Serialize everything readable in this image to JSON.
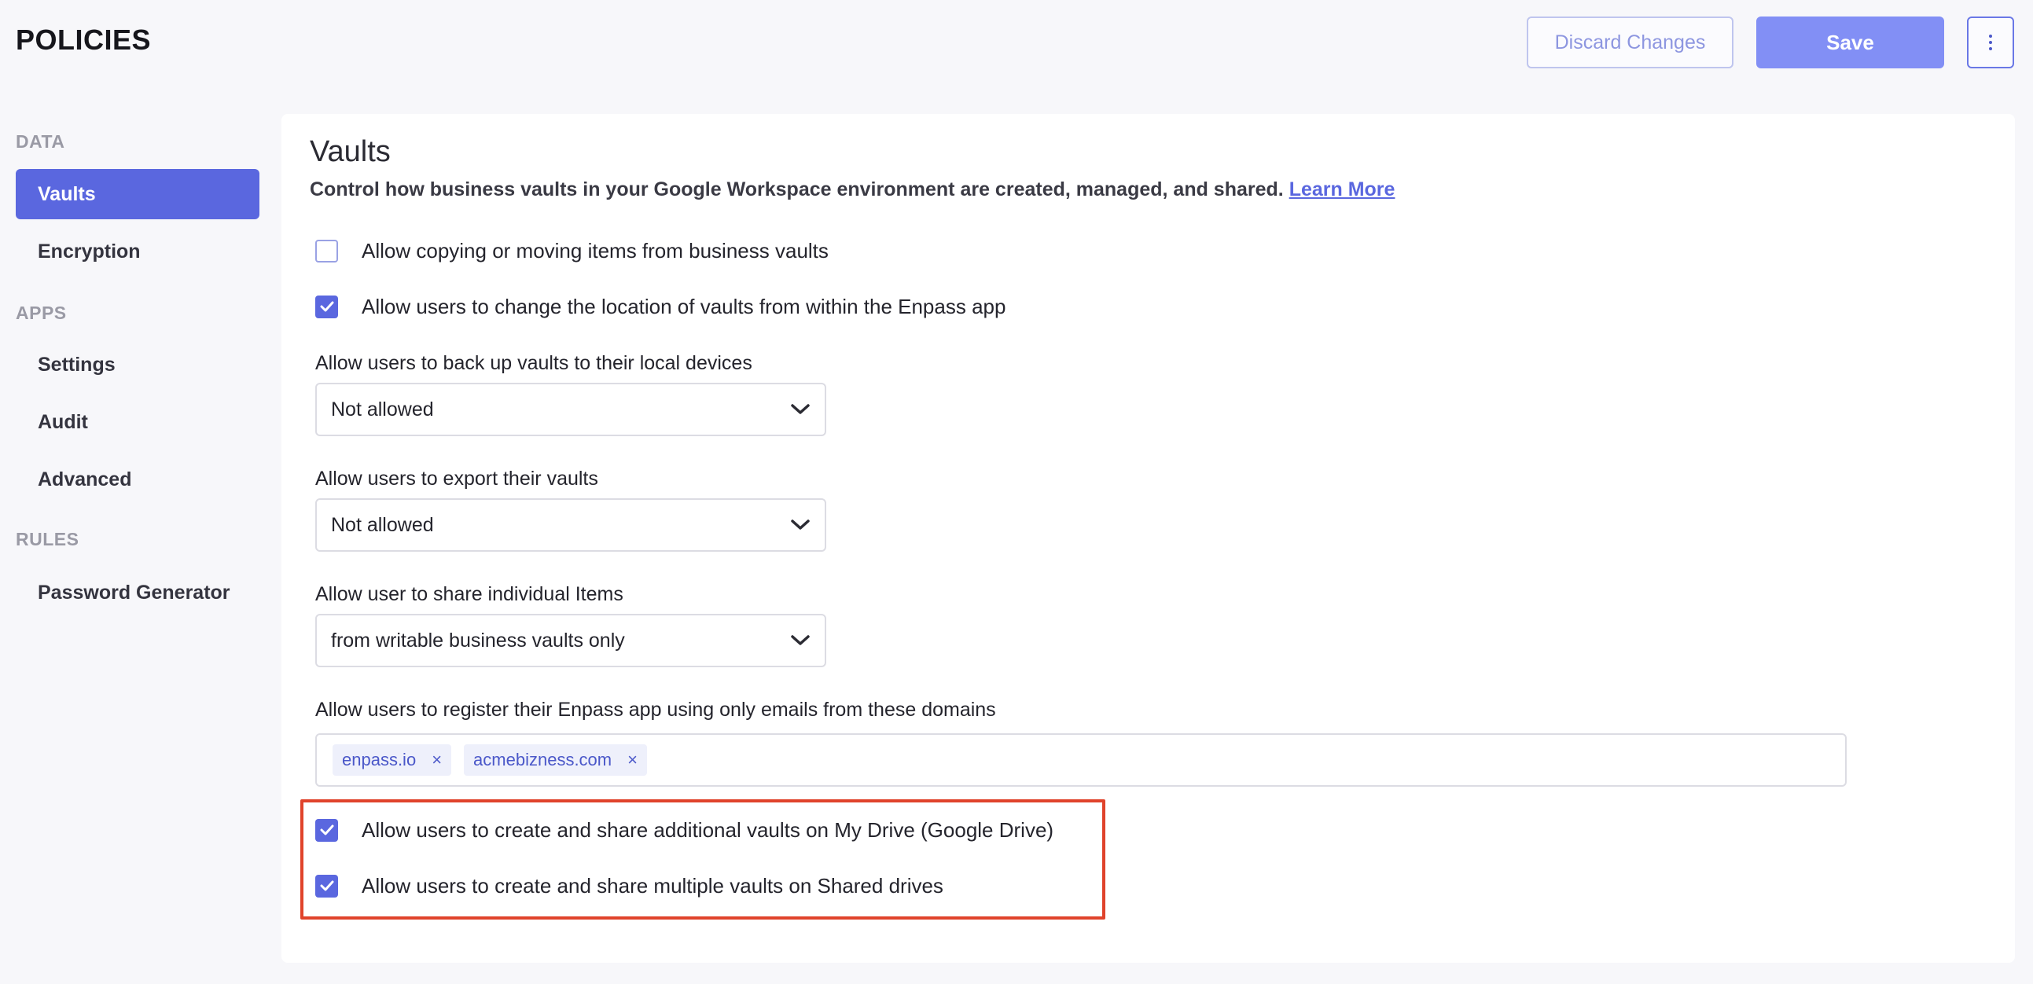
{
  "header": {
    "title": "POLICIES",
    "discard_label": "Discard Changes",
    "save_label": "Save",
    "more_icon": "kebab-vertical-icon"
  },
  "sidebar": {
    "sections": [
      {
        "label": "DATA",
        "items": [
          {
            "label": "Vaults",
            "active": true
          },
          {
            "label": "Encryption"
          }
        ]
      },
      {
        "label": "APPS",
        "items": [
          {
            "label": "Settings"
          },
          {
            "label": "Audit"
          },
          {
            "label": "Advanced"
          }
        ]
      },
      {
        "label": "RULES",
        "items": [
          {
            "label": "Password Generator"
          }
        ]
      }
    ]
  },
  "main": {
    "title": "Vaults",
    "description": "Control how business vaults in your Google Workspace environment are created, managed, and shared.",
    "learn_more": "Learn More",
    "options": [
      {
        "label": "Allow copying or moving items from business vaults",
        "checked": false
      },
      {
        "label": "Allow users to change the location of vaults from within the Enpass app",
        "checked": true
      }
    ],
    "selects": [
      {
        "label": "Allow users to back up vaults to their local devices",
        "value": "Not allowed"
      },
      {
        "label": "Allow users to export their vaults",
        "value": "Not allowed"
      },
      {
        "label": "Allow user to share individual Items",
        "value": "from writable business vaults only"
      }
    ],
    "domains": {
      "label": "Allow users to register their Enpass app using only emails from these domains",
      "tags": [
        "enpass.io",
        "acmebizness.com"
      ],
      "remove_glyph": "×"
    },
    "drive_options": [
      {
        "label": "Allow users to create and share additional vaults on My Drive (Google Drive)",
        "checked": true
      },
      {
        "label": "Allow users to create and share multiple vaults on Shared drives",
        "checked": true
      }
    ]
  },
  "colors": {
    "accent": "#5a67df",
    "save": "#828ff5",
    "highlight": "#e0432b"
  }
}
